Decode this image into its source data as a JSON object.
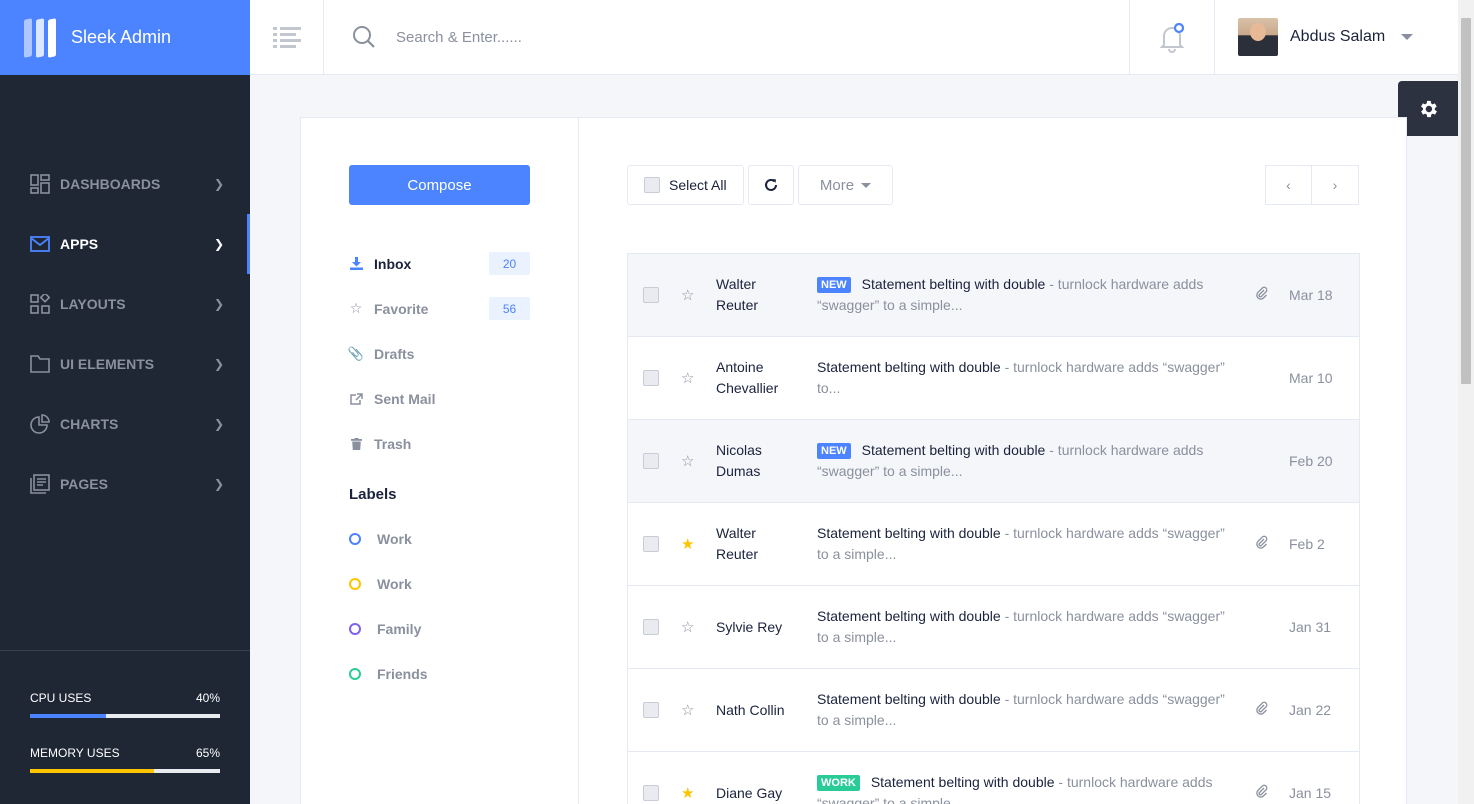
{
  "brand": {
    "name": "Sleek Admin"
  },
  "colors": {
    "primary": "#4c84ff",
    "sidebar": "#1f2735",
    "warning": "#fec400",
    "success": "#29cc97",
    "purple": "#8061ef"
  },
  "nav": [
    {
      "label": "DASHBOARDS",
      "icon": "dashboard-icon"
    },
    {
      "label": "APPS",
      "icon": "mail-icon",
      "active": true
    },
    {
      "label": "LAYOUTS",
      "icon": "layouts-icon"
    },
    {
      "label": "UI ELEMENTS",
      "icon": "folder-icon"
    },
    {
      "label": "CHARTS",
      "icon": "chart-pie-icon"
    },
    {
      "label": "PAGES",
      "icon": "pages-icon"
    }
  ],
  "usage": [
    {
      "label": "CPU USES",
      "value": "40%",
      "fraction": 0.4,
      "color": "#4c84ff"
    },
    {
      "label": "MEMORY USES",
      "value": "65%",
      "fraction": 0.65,
      "color": "#fec400"
    }
  ],
  "header": {
    "search_placeholder": "Search & Enter......",
    "user_name": "Abdus Salam"
  },
  "compose_label": "Compose",
  "folders": [
    {
      "label": "Inbox",
      "icon": "download-icon",
      "count": "20",
      "active": true
    },
    {
      "label": "Favorite",
      "icon": "star-icon",
      "count": "56"
    },
    {
      "label": "Drafts",
      "icon": "paperclip-icon"
    },
    {
      "label": "Sent Mail",
      "icon": "share-icon"
    },
    {
      "label": "Trash",
      "icon": "trash-icon"
    }
  ],
  "labels_title": "Labels",
  "labels": [
    {
      "label": "Work",
      "color": "#4c84ff"
    },
    {
      "label": "Work",
      "color": "#fec400"
    },
    {
      "label": "Family",
      "color": "#8061ef"
    },
    {
      "label": "Friends",
      "color": "#29cc97"
    }
  ],
  "toolbar": {
    "select_all": "Select All",
    "more": "More"
  },
  "mails": [
    {
      "sender": "Walter Reuter",
      "tag": "NEW",
      "tag_color": "#4c84ff",
      "subject": "Statement belting with double",
      "preview": " - turnlock hardware adds “swagger” to a simple...",
      "date": "Mar 18",
      "attachment": true,
      "starred": false,
      "unread": true
    },
    {
      "sender": "Antoine Chevallier",
      "tag": "",
      "subject": "Statement belting with double",
      "preview": " - turnlock hardware adds “swagger” to...",
      "date": "Mar 10",
      "attachment": false,
      "starred": false,
      "unread": false
    },
    {
      "sender": "Nicolas Dumas",
      "tag": "NEW",
      "tag_color": "#4c84ff",
      "subject": "Statement belting with double",
      "preview": " - turnlock hardware adds “swagger” to a simple...",
      "date": "Feb 20",
      "attachment": false,
      "starred": false,
      "unread": true
    },
    {
      "sender": "Walter Reuter",
      "tag": "",
      "subject": "Statement belting with double",
      "preview": " - turnlock hardware adds “swagger” to a simple...",
      "date": "Feb 2",
      "attachment": true,
      "starred": true,
      "unread": false
    },
    {
      "sender": "Sylvie Rey",
      "tag": "",
      "subject": "Statement belting with double",
      "preview": " - turnlock hardware adds “swagger” to a simple...",
      "date": "Jan 31",
      "attachment": false,
      "starred": false,
      "unread": false
    },
    {
      "sender": "Nath Collin",
      "tag": "",
      "subject": "Statement belting with double",
      "preview": " - turnlock hardware adds “swagger” to a simple...",
      "date": "Jan 22",
      "attachment": true,
      "starred": false,
      "unread": false
    },
    {
      "sender": "Diane Gay",
      "tag": "WORK",
      "tag_color": "#29cc97",
      "subject": "Statement belting with double",
      "preview": " - turnlock hardware adds “swagger” to a simple...",
      "date": "Jan 15",
      "attachment": true,
      "starred": true,
      "unread": false
    }
  ]
}
